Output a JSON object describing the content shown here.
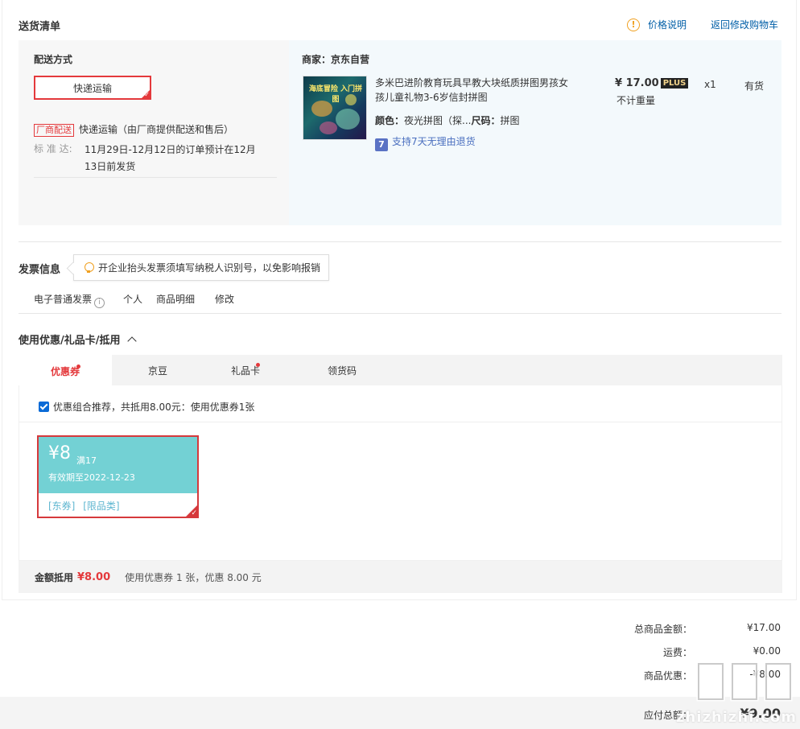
{
  "header": {
    "title": "送货清单",
    "price_info": "价格说明",
    "return_cart": "返回修改购物车"
  },
  "delivery": {
    "method_label": "配送方式",
    "method_value": "快递运输",
    "vendor_tag": "厂商配送",
    "vendor_desc": "快递运输（由厂商提供配送和售后）",
    "standard_label": "标 准 达:",
    "standard_line1": "11月29日-12月12日的订单预计在12月",
    "standard_line2": "13日前发货"
  },
  "product": {
    "merchant": "商家：京东自营",
    "image_text": "海底冒险 入门拼图",
    "title_line1": "多米巴进阶教育玩具早教大块纸质拼图男孩女",
    "title_line2": "孩儿童礼物3-6岁信封拼图",
    "color_label": "颜色：",
    "color_value": "夜光拼图（探...",
    "size_label": "尺码：",
    "size_value": "拼图",
    "return_icon": "7",
    "return_policy": "支持7天无理由退货",
    "price": "¥ 17.00",
    "plus_badge": "PLUS",
    "weight": "不计重量",
    "qty": "x1",
    "stock": "有货"
  },
  "invoice": {
    "title": "发票信息",
    "tip": "开企业抬头发票须填写纳税人识别号，以免影响报销",
    "type": "电子普通发票",
    "info_icon": "i",
    "person": "个人",
    "detail": "商品明细",
    "modify": "修改"
  },
  "discount": {
    "title": "使用优惠/礼品卡/抵用",
    "tabs": [
      {
        "label": "优惠券"
      },
      {
        "label": "京豆"
      },
      {
        "label": "礼品卡"
      },
      {
        "label": "领货码"
      }
    ],
    "recommend": "优惠组合推荐，共抵用8.00元：使用优惠券1张",
    "coupon": {
      "amount": "¥8",
      "condition": "满17",
      "expiry": "有效期至2022-12-23",
      "tag1": "[东券]",
      "tag2": "[限品类]"
    },
    "summary_label": "金额抵用",
    "summary_amount": "¥8.00",
    "summary_desc": "使用优惠券 1 张，优惠 8.00 元"
  },
  "totals": {
    "items_label": "总商品金额：",
    "items_value": "¥17.00",
    "shipping_label": "运费：",
    "shipping_value": "¥0.00",
    "discount_label": "商品优惠：",
    "discount_value": "-¥8.00",
    "payable_label": "应付总额：",
    "payable_value": "¥9.00"
  },
  "watermark": {
    "text": "zhizhizhi.com"
  }
}
